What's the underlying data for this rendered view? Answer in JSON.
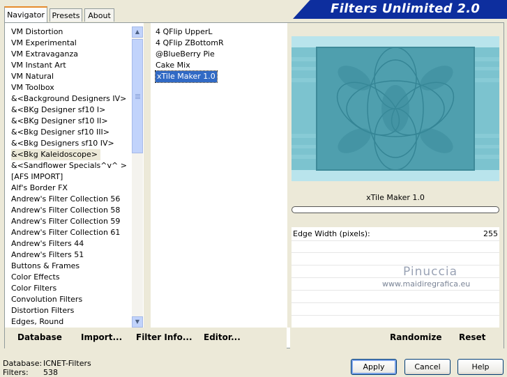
{
  "tabs": [
    "Navigator",
    "Presets",
    "About"
  ],
  "app_title": "Filters Unlimited 2.0",
  "categories": [
    "VM Distortion",
    "VM Experimental",
    "VM Extravaganza",
    "VM Instant Art",
    "VM Natural",
    "VM Toolbox",
    "&<Background Designers IV>",
    "&<BKg Designer sf10 I>",
    "&<BKg Designer sf10 II>",
    "&<Bkg Designer sf10 III>",
    "&<Bkg Designers sf10 IV>",
    "&<Bkg Kaleidoscope>",
    "&<Sandflower Specials^v^ >",
    "[AFS IMPORT]",
    "Alf's Border FX",
    "Andrew's Filter Collection 56",
    "Andrew's Filter Collection 58",
    "Andrew's Filter Collection 59",
    "Andrew's Filter Collection 61",
    "Andrew's Filters 44",
    "Andrew's Filters 51",
    "Buttons & Frames",
    "Color Effects",
    "Color Filters",
    "Convolution Filters",
    "Distortion Filters",
    "Edges, Round"
  ],
  "selected_category": "&<Bkg Kaleidoscope>",
  "filters": [
    "4 QFlip UpperL",
    "4 QFlip ZBottomR",
    "@BlueBerry Pie",
    "Cake Mix",
    "xTile Maker 1.0"
  ],
  "selected_filter": "xTile Maker 1.0",
  "filter_name": "xTile Maker 1.0",
  "params": {
    "label": "Edge Width (pixels):",
    "value": "255"
  },
  "watermark": {
    "name": "Pinuccia",
    "url": "www.maidiregrafica.eu"
  },
  "bottom_buttons": {
    "database": "Database",
    "import": "Import...",
    "filter_info": "Filter Info...",
    "editor": "Editor...",
    "randomize": "Randomize",
    "reset": "Reset"
  },
  "status": {
    "database_label": "Database:",
    "database_value": "ICNET-Filters",
    "filters_label": "Filters:",
    "filters_value": "538"
  },
  "dialog_buttons": {
    "apply": "Apply",
    "cancel": "Cancel",
    "help": "Help"
  },
  "colors": {
    "banner": "#0d2e9e",
    "selection": "#316ac5",
    "preview_bg": "#b9e4ec",
    "preview_tile": "#4f9fae"
  },
  "icons": {
    "scroll_up": "scroll-up-arrow-icon",
    "scroll_down": "scroll-down-arrow-icon"
  }
}
